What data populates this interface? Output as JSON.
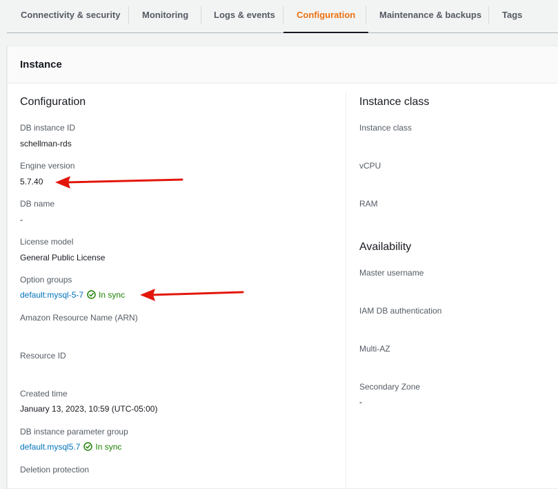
{
  "tabs": [
    {
      "label": "Connectivity & security",
      "active": false
    },
    {
      "label": "Monitoring",
      "active": false
    },
    {
      "label": "Logs & events",
      "active": false
    },
    {
      "label": "Configuration",
      "active": true
    },
    {
      "label": "Maintenance & backups",
      "active": false
    },
    {
      "label": "Tags",
      "active": false
    }
  ],
  "panel": {
    "title": "Instance"
  },
  "configuration": {
    "title": "Configuration",
    "db_instance_id": {
      "label": "DB instance ID",
      "value": "schellman-rds"
    },
    "engine_version": {
      "label": "Engine version",
      "value": "5.7.40"
    },
    "db_name": {
      "label": "DB name",
      "value": "-"
    },
    "license_model": {
      "label": "License model",
      "value": "General Public License"
    },
    "option_groups": {
      "label": "Option groups",
      "link": "default:mysql-5-7",
      "status": "In sync"
    },
    "arn": {
      "label": "Amazon Resource Name (ARN)"
    },
    "resource_id": {
      "label": "Resource ID"
    },
    "created_time": {
      "label": "Created time",
      "value": "January 13, 2023, 10:59 (UTC-05:00)"
    },
    "parameter_group": {
      "label": "DB instance parameter group",
      "link": "default.mysql5.7",
      "status": "In sync"
    },
    "deletion_protection": {
      "label": "Deletion protection"
    }
  },
  "instance_class": {
    "title": "Instance class",
    "instance_class": {
      "label": "Instance class"
    },
    "vcpu": {
      "label": "vCPU"
    },
    "ram": {
      "label": "RAM"
    }
  },
  "availability": {
    "title": "Availability",
    "master_username": {
      "label": "Master username"
    },
    "iam_db_auth": {
      "label": "IAM DB authentication"
    },
    "multi_az": {
      "label": "Multi-AZ"
    },
    "secondary_zone": {
      "label": "Secondary Zone",
      "value": "-"
    }
  },
  "colors": {
    "active_tab": "#ec7211",
    "link": "#0073bb",
    "success": "#1d8102",
    "annotation_arrow": "#e3160b"
  },
  "icons": {
    "status": "check-circle-icon",
    "annotation": "red-arrow-annotation"
  }
}
